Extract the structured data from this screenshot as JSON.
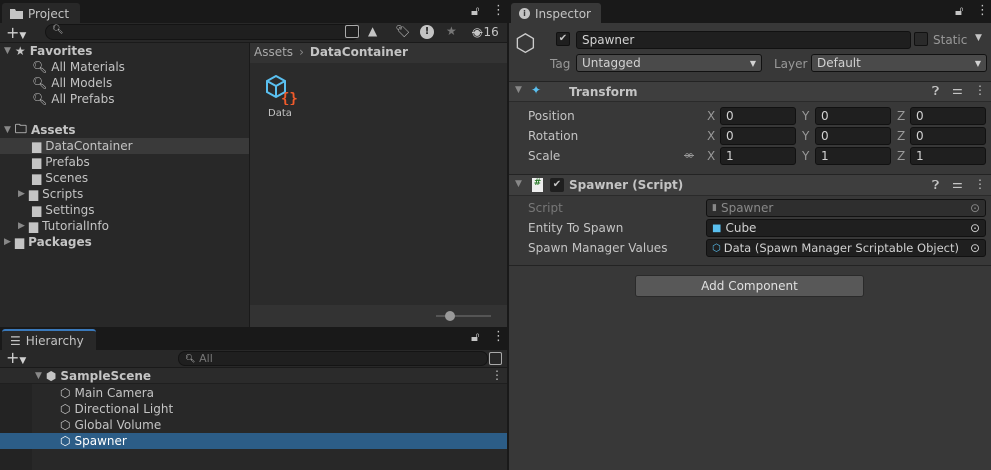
{
  "project": {
    "tab": "Project",
    "search_placeholder": "",
    "hidden_count": "16",
    "favorites": {
      "label": "Favorites",
      "items": [
        "All Materials",
        "All Models",
        "All Prefabs"
      ]
    },
    "assets": {
      "label": "Assets",
      "folders": [
        {
          "name": "DataContainer",
          "selected": true,
          "expandable": false
        },
        {
          "name": "Prefabs",
          "expandable": false
        },
        {
          "name": "Scenes",
          "expandable": false
        },
        {
          "name": "Scripts",
          "expandable": true
        },
        {
          "name": "Settings",
          "expandable": false
        },
        {
          "name": "TutorialInfo",
          "expandable": true
        }
      ]
    },
    "packages": "Packages",
    "breadcrumb": [
      "Assets",
      "DataContainer"
    ],
    "grid_items": [
      {
        "name": "Data"
      }
    ],
    "icon_size": 0.3
  },
  "hierarchy": {
    "tab": "Hierarchy",
    "search_placeholder": "All",
    "scene": "SampleScene",
    "items": [
      {
        "name": "Main Camera"
      },
      {
        "name": "Directional Light"
      },
      {
        "name": "Global Volume"
      },
      {
        "name": "Spawner",
        "selected": true
      }
    ]
  },
  "inspector": {
    "tab": "Inspector",
    "object_name": "Spawner",
    "static_label": "Static",
    "tag_label": "Tag",
    "tag_value": "Untagged",
    "layer_label": "Layer",
    "layer_value": "Default",
    "transform": {
      "title": "Transform",
      "rows": [
        {
          "label": "Position",
          "x": "0",
          "y": "0",
          "z": "0"
        },
        {
          "label": "Rotation",
          "x": "0",
          "y": "0",
          "z": "0"
        },
        {
          "label": "Scale",
          "x": "1",
          "y": "1",
          "z": "1"
        }
      ],
      "axis": [
        "X",
        "Y",
        "Z"
      ]
    },
    "script": {
      "title": "Spawner (Script)",
      "fields": [
        {
          "label": "Script",
          "value": "Spawner",
          "disabled": true
        },
        {
          "label": "Entity To Spawn",
          "value": "Cube"
        },
        {
          "label": "Spawn Manager Values",
          "value": "Data (Spawn Manager Scriptable Object)"
        }
      ]
    },
    "add_component": "Add Component"
  },
  "colors": {
    "selection": "#2c5d87",
    "accent": "#3a79bb"
  }
}
